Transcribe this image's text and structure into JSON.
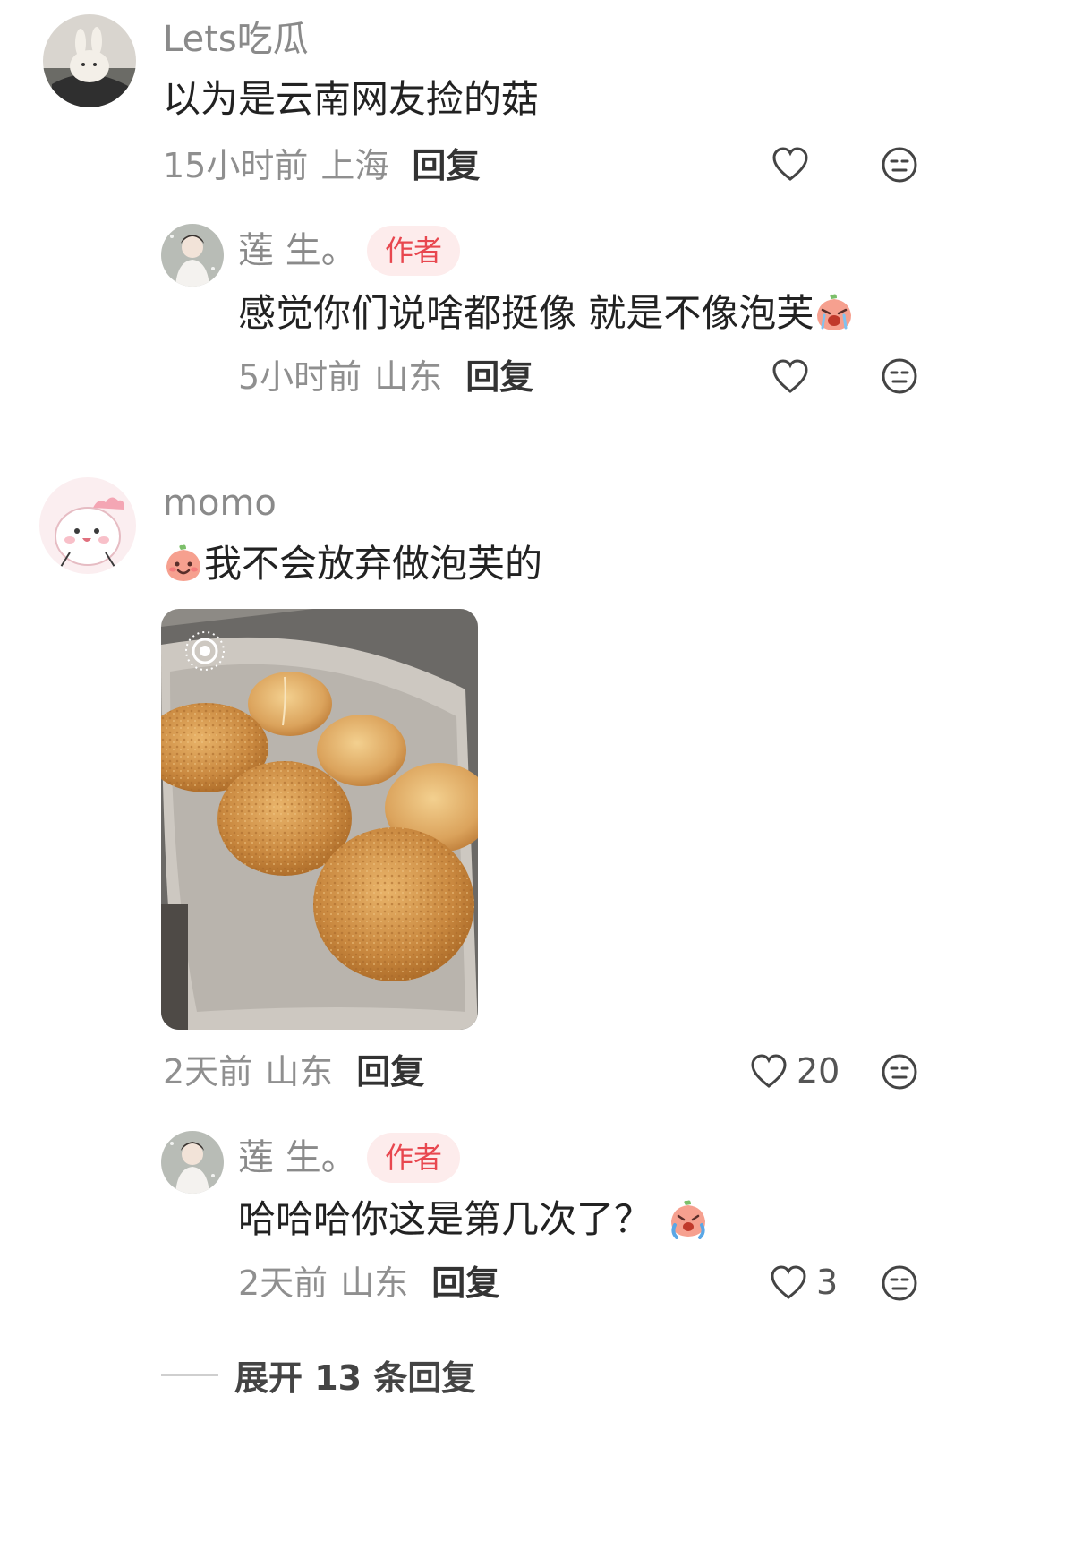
{
  "comments": [
    {
      "user": "Lets吃瓜",
      "text": "以为是云南网友捡的菇",
      "time": "15小时前",
      "location": "上海",
      "reply_label": "回复",
      "likes": "",
      "replies": [
        {
          "user": "莲 生。",
          "badge": "作者",
          "text": "感觉你们说啥都挺像 就是不像泡芙",
          "time": "5小时前",
          "location": "山东",
          "reply_label": "回复",
          "likes": ""
        }
      ]
    },
    {
      "user": "momo",
      "text": "我不会放弃做泡芙的",
      "time": "2天前",
      "location": "山东",
      "reply_label": "回复",
      "likes": "20",
      "replies": [
        {
          "user": "莲 生。",
          "badge": "作者",
          "text": "哈哈哈你这是第几次了？",
          "time": "2天前",
          "location": "山东",
          "reply_label": "回复",
          "likes": "3"
        }
      ],
      "expand_label": "展开 13 条回复"
    }
  ],
  "icons": {
    "like": "heart-outline-icon",
    "dislike": "neutral-face-icon",
    "photo_badge": "live-photo-icon"
  },
  "colors": {
    "author_badge_bg": "#fdecec",
    "author_badge_text": "#e8474f",
    "meta_text": "#8f8f8f"
  }
}
